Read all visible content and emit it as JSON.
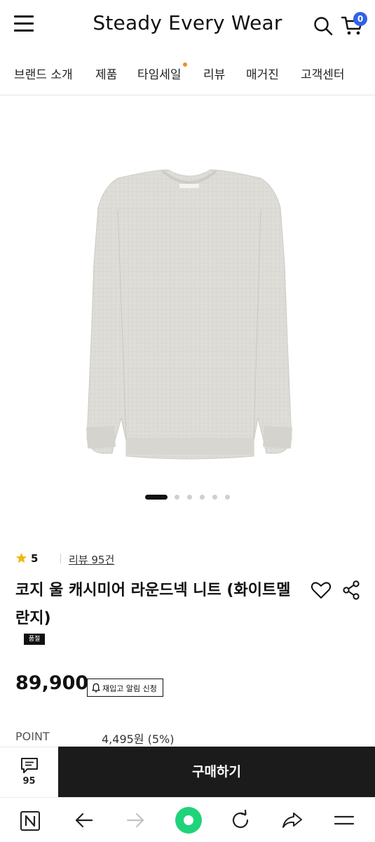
{
  "header": {
    "brand": "Steady Every Wear",
    "cart_count": "0"
  },
  "nav": {
    "items": [
      {
        "label": "브랜드 소개"
      },
      {
        "label": "제품"
      },
      {
        "label": "타임세일"
      },
      {
        "label": "리뷰"
      },
      {
        "label": "매거진"
      },
      {
        "label": "고객센터"
      }
    ]
  },
  "product": {
    "image": "gray-knit-sweater",
    "carousel_total": 6,
    "carousel_active": 1,
    "rating": "5",
    "review_link": "리뷰 95건",
    "title": "코지 울 캐시미어 라운드넥 니트 (화이트멜란지)",
    "soldout_badge": "품절",
    "price": "89,900",
    "restock_button": "재입고 알림 신청",
    "point_label": "POINT",
    "point_value": "4,495원 (5%)"
  },
  "bottom_bar": {
    "chat_count": "95",
    "buy_label": "구매하기"
  },
  "colors": {
    "accent_badge": "#2e62e8",
    "nav_dot": "#f28c28",
    "buy_button": "#1b1b1b",
    "browser_home": "#1fd37a"
  }
}
